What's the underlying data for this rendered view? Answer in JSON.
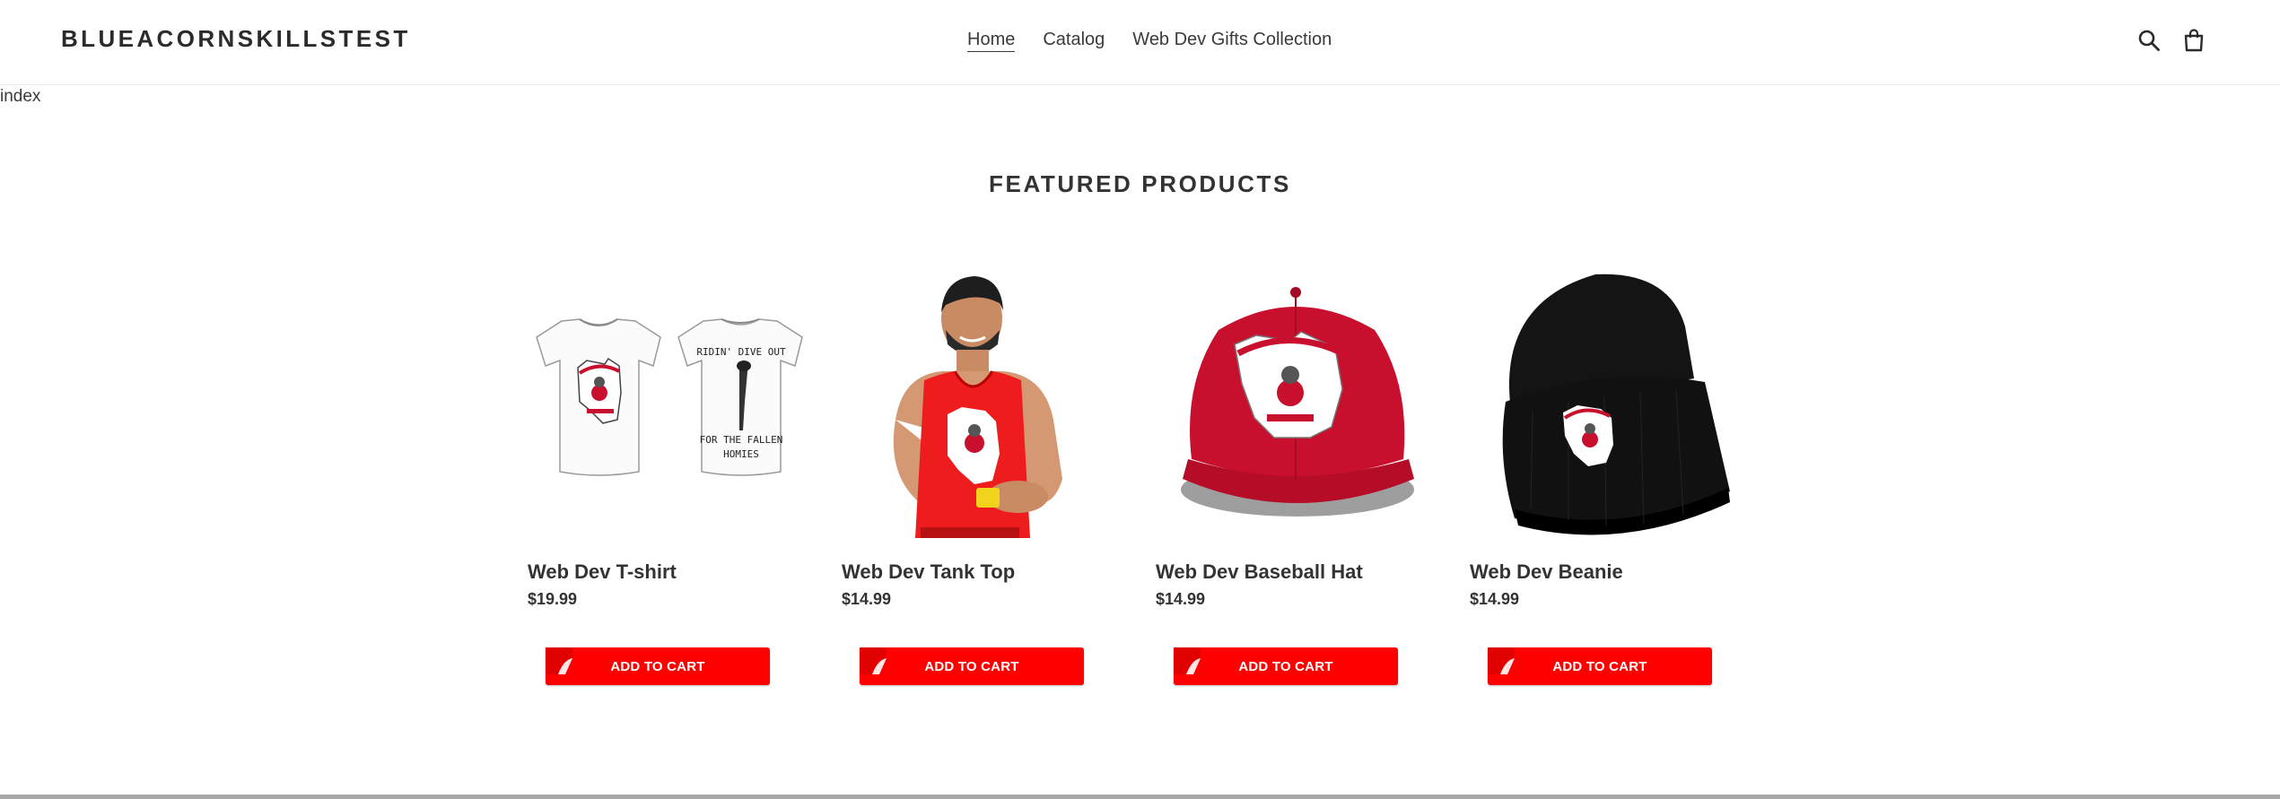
{
  "header": {
    "logo": "BLUEACORNSKILLSTEST",
    "nav": [
      {
        "label": "Home"
      },
      {
        "label": "Catalog"
      },
      {
        "label": "Web Dev Gifts Collection"
      }
    ],
    "icons": [
      "search-icon",
      "cart-icon"
    ]
  },
  "template_label": "index",
  "featured": {
    "title": "FEATURED PRODUCTS",
    "products": [
      {
        "title": "Web Dev T-shirt",
        "price": "$19.99",
        "button": "ADD TO CART"
      },
      {
        "title": "Web Dev Tank Top",
        "price": "$14.99",
        "button": "ADD TO CART"
      },
      {
        "title": "Web Dev Baseball Hat",
        "price": "$14.99",
        "button": "ADD TO CART"
      },
      {
        "title": "Web Dev Beanie",
        "price": "$14.99",
        "button": "ADD TO CART"
      }
    ]
  },
  "colors": {
    "accent": "#ff0000",
    "text": "#3a3a3a",
    "hat_red": "#c8102e"
  }
}
